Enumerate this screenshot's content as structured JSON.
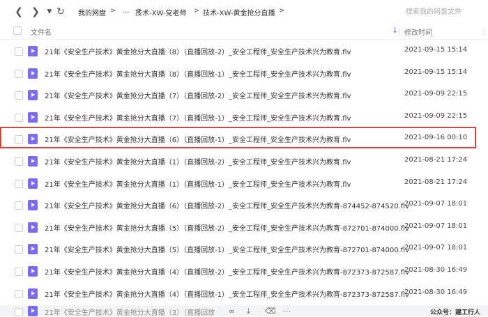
{
  "nav": {
    "back_icon": "chevron-left-icon",
    "forward_icon": "chevron-right-icon",
    "dropdown_icon": "caret-down-icon",
    "refresh_icon": "refresh-icon"
  },
  "breadcrumb": {
    "items": [
      "我的网盘",
      "...",
      "技术-XW-党老师",
      "技术-XW-黄金抢分直播"
    ],
    "separator": ">"
  },
  "search": {
    "placeholder": "搜索我的网盘文件"
  },
  "table": {
    "header_name": "文件名",
    "header_date": "修改时间",
    "rows": [
      {
        "name": "21年《安全生产技术》黄金抢分大直播（8）（直播回放-2）_安全工程师_安全生产技术兴为教育.flv",
        "date": "2021-09-15 15:14"
      },
      {
        "name": "21年《安全生产技术》黄金抢分大直播（8）（直播回放-1）_安全工程师_安全生产技术兴为教育.flv",
        "date": "2021-09-15 15:14"
      },
      {
        "name": "21年《安全生产技术》黄金抢分大直播（7）（直播回放-2）_安全工程师_安全生产技术兴为教育.flv",
        "date": "2021-09-09 22:15"
      },
      {
        "name": "21年《安全生产技术》黄金抢分大直播（7）（直播回放-1）_安全工程师_安全生产技术兴为教育.flv",
        "date": "2021-09-09 22:15"
      },
      {
        "name": "21年《安全生产技术》黄金抢分大直播（6）（直播回放-1）_安全工程师_安全生产技术兴为教育.flv",
        "date": "2021-09-16 00:10"
      },
      {
        "name": "21年《安全生产技术》黄金抢分大直播（1）（直播回放-2）_安全工程师_安全生产技术兴为教育.flv",
        "date": "2021-08-21 17:24"
      },
      {
        "name": "21年《安全生产技术》黄金抢分大直播（1）（直播回放-1）_安全工程师_安全生产技术兴为教育.flv",
        "date": "2021-08-21 17:24"
      },
      {
        "name": "21年《安全生产技术》黄金抢分大直播（6）（直播回放-2）_安全工程师_安全生产技术兴为教育-874452-874520.flv",
        "date": "2021-09-07 18:01"
      },
      {
        "name": "21年《安全生产技术》黄金抢分大直播（5）（直播回放-2）_安全工程师_安全生产技术兴为教育-872701-874000.flv",
        "date": "2021-09-07 18:01"
      },
      {
        "name": "21年《安全生产技术》黄金抢分大直播（5）（直播回放-1）_安全工程师_安全生产技术兴为教育-872701-874000.flv",
        "date": "2021-09-07 18:01"
      },
      {
        "name": "21年《安全生产技术》黄金抢分大直播（4）（直播回放-2）_安全工程师_安全生产技术兴为教育-872373-872587.flv",
        "date": "2021-08-30 16:49"
      },
      {
        "name": "21年《安全生产技术》黄金抢分大直播（4）（直播回放-1）_安全工程师_安全生产技术兴为教育-872373-872587.flv",
        "date": "2021-08-30 16:49"
      }
    ],
    "partial_row": {
      "name": "21年《安全生产技术》黄金抢分大直播（3）（直播回放"
    }
  },
  "toolbar": {
    "icons": [
      "share-icon",
      "download-icon",
      "delete-icon",
      "more-icon"
    ]
  },
  "watermark": "公众号：建工行人",
  "colors": {
    "accent": "#3d7dfc",
    "video_icon": "#7b6cf5",
    "highlight_border": "#e33b3b"
  }
}
